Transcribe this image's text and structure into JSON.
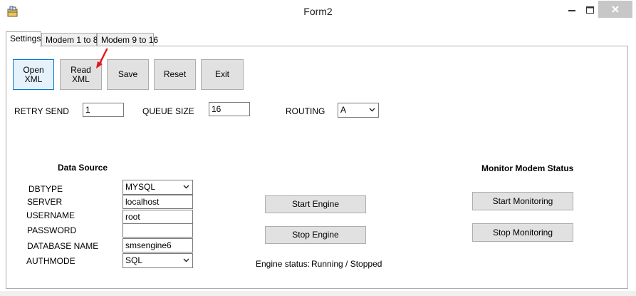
{
  "window": {
    "title": "Form2",
    "icon": "app-icon"
  },
  "tabs": [
    {
      "label": "Settings"
    },
    {
      "label": "Modem 1 to 8"
    },
    {
      "label": "Modem 9 to 16"
    }
  ],
  "toolbar": {
    "open_xml_line1": "Open",
    "open_xml_line2": "XML",
    "read_xml_line1": "Read",
    "read_xml_line2": "XML",
    "save_label": "Save",
    "reset_label": "Reset",
    "exit_label": "Exit"
  },
  "settings": {
    "retry_send_label": "RETRY SEND",
    "retry_send_value": "1",
    "queue_size_label": "QUEUE SIZE",
    "queue_size_value": "16",
    "routing_label": "ROUTING",
    "routing_value": "A"
  },
  "data_source": {
    "heading": "Data Source",
    "dbtype_label": "DBTYPE",
    "dbtype_value": "MYSQL",
    "server_label": "SERVER",
    "server_value": "localhost",
    "username_label": "USERNAME",
    "username_value": "root",
    "password_label": "PASSWORD",
    "password_value": "",
    "database_name_label": "DATABASE NAME",
    "database_name_value": "smsengine6",
    "authmode_label": "AUTHMODE",
    "authmode_value": "SQL"
  },
  "engine": {
    "start_label": "Start Engine",
    "stop_label": "Stop Engine",
    "status_label": "Engine status:",
    "status_value": "Running / Stopped"
  },
  "monitor": {
    "heading": "Monitor Modem Status",
    "start_label": "Start Monitoring",
    "stop_label": "Stop Monitoring"
  },
  "colors": {
    "annotation_arrow": "#e8141c",
    "focus_border": "#0078d7",
    "close_button_bg": "#c7c7c7"
  }
}
